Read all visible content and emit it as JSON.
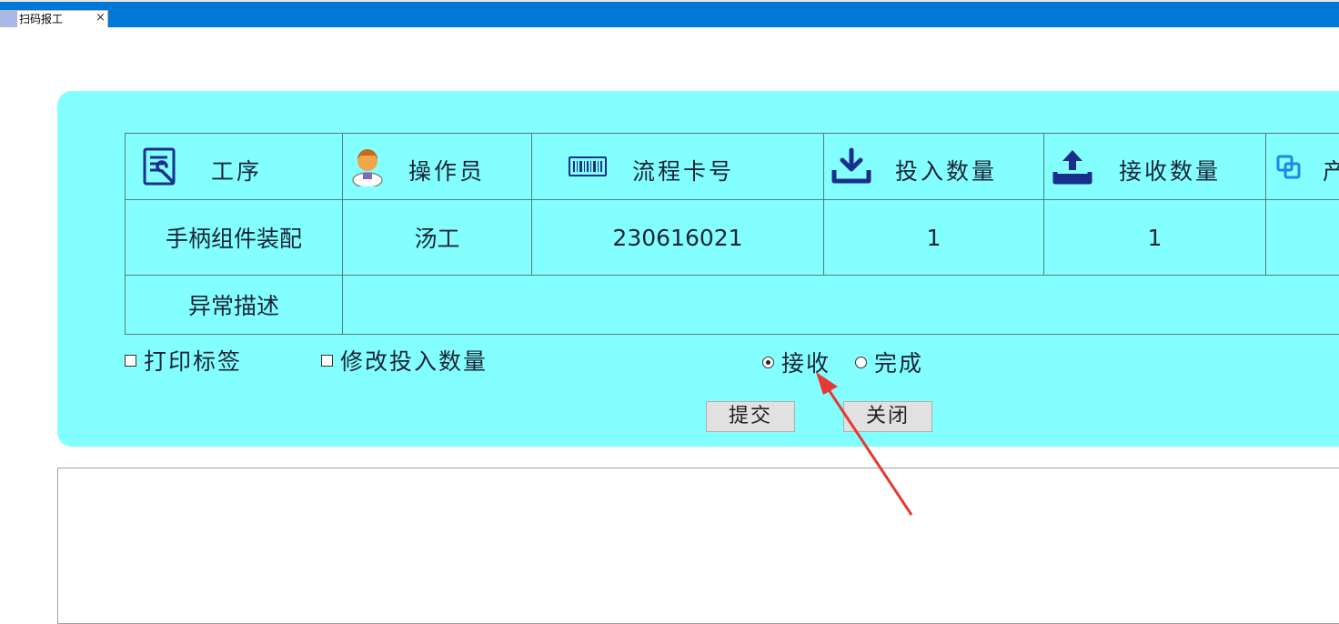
{
  "tab": {
    "label": "扫码报工",
    "close_glyph": "×"
  },
  "table": {
    "headers": [
      {
        "label": "工序",
        "icon": "process-doc-icon"
      },
      {
        "label": "操作员",
        "icon": "operator-avatar-icon"
      },
      {
        "label": "流程卡号",
        "icon": "barcode-icon"
      },
      {
        "label": "投入数量",
        "icon": "download-icon"
      },
      {
        "label": "接收数量",
        "icon": "upload-icon"
      },
      {
        "label": "产",
        "icon": "copy-icon"
      }
    ],
    "row": [
      "手柄组件装配",
      "汤工",
      "230616021",
      "1",
      "1",
      ""
    ],
    "exception_label": "异常描述",
    "exception_value": ""
  },
  "options": {
    "print_label": "打印标签",
    "modify_qty": "修改投入数量",
    "receive": "接收",
    "complete": "完成",
    "selected": "receive"
  },
  "buttons": {
    "submit": "提交",
    "close": "关闭"
  },
  "colors": {
    "titlebar": "#0078d7",
    "panel": "#83ffff",
    "icon_blue": "#1a2f8c",
    "annotation_arrow": "#e53935"
  }
}
